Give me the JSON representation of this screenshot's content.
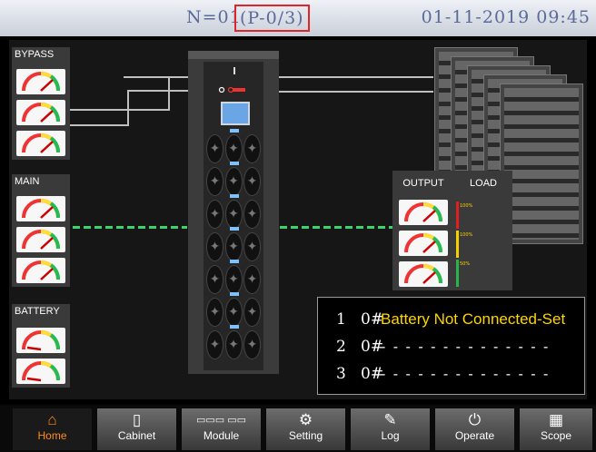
{
  "topbar": {
    "n_label": "N=01",
    "p_label": "(P-0/3)",
    "datetime": "01-11-2019 09:45"
  },
  "panels": {
    "bypass": "BYPASS",
    "main": "MAIN",
    "battery": "BATTERY",
    "output": "OUTPUT",
    "load": "LOAD"
  },
  "load_levels": [
    "100%",
    "100%",
    "50%"
  ],
  "messages": [
    {
      "num": "1",
      "hash": "0#",
      "text": "Battery Not Connected-Set"
    },
    {
      "num": "2",
      "hash": "0#",
      "text": "- - - - - - - - - - - - - -"
    },
    {
      "num": "3",
      "hash": "0#",
      "text": "- - - - - - - - - - - - - -"
    }
  ],
  "nav": {
    "items": [
      {
        "label": "Home",
        "icon": "home-icon"
      },
      {
        "label": "Cabinet",
        "icon": "cabinet-icon"
      },
      {
        "label": "Module",
        "icon": "module-icon"
      },
      {
        "label": "Setting",
        "icon": "gear-icon"
      },
      {
        "label": "Log",
        "icon": "log-icon"
      },
      {
        "label": "Operate",
        "icon": "power-icon"
      },
      {
        "label": "Scope",
        "icon": "scope-icon"
      }
    ],
    "active": "Home"
  },
  "colors": {
    "accent_active": "#ff8c1a",
    "message_warning": "#ffd400",
    "line_active": "#3fd16a",
    "header_highlight": "#e0252a"
  }
}
